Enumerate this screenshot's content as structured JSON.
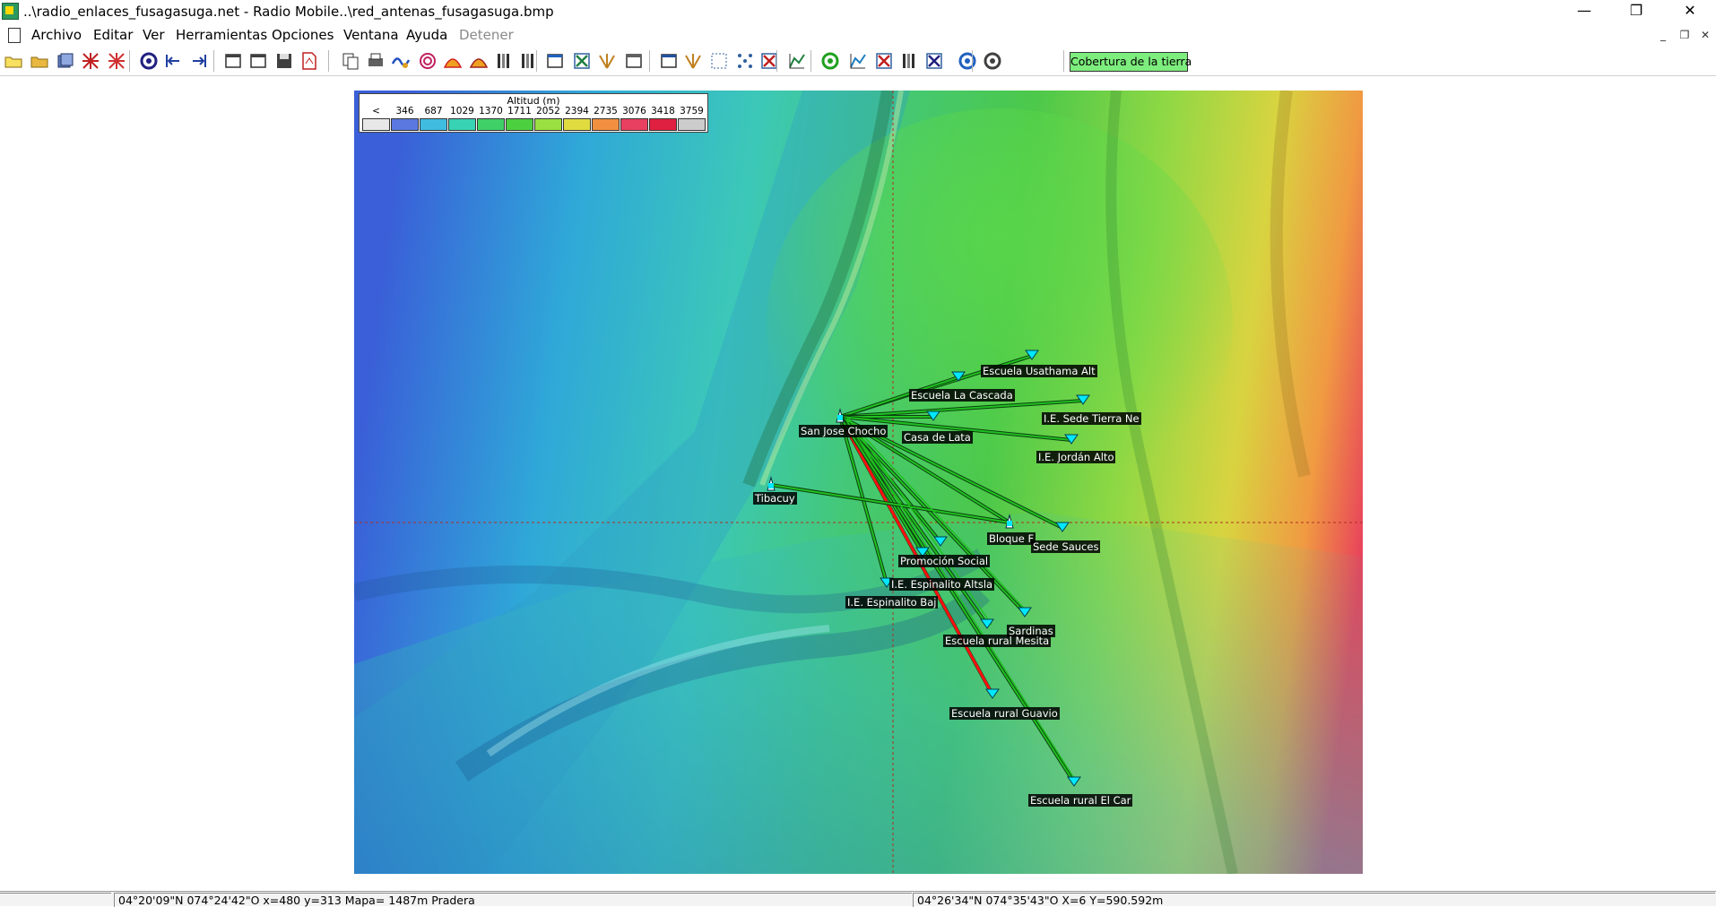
{
  "window": {
    "title": "..\\radio_enlaces_fusagasuga.net - Radio Mobile..\\red_antenas_fusagasuga.bmp",
    "minimize_glyph": "—",
    "restore_glyph": "❐",
    "close_glyph": "✕"
  },
  "menu": {
    "items": [
      {
        "label": "Archivo"
      },
      {
        "label": "Editar"
      },
      {
        "label": "Ver"
      },
      {
        "label": "Herramientas"
      },
      {
        "label": "Opciones"
      },
      {
        "label": "Ventana"
      },
      {
        "label": "Ayuda"
      },
      {
        "label": "Detener"
      }
    ],
    "mdi_minimize": "_",
    "mdi_restore": "❐",
    "mdi_close": "✕"
  },
  "toolbar": {
    "coverage_button": "Cobertura de la tierra",
    "icons": [
      "new-icon",
      "open-icon",
      "save-all-icon",
      "network-icon",
      "antenna-icon",
      "globe-icon",
      "first-icon",
      "last-icon",
      "window-icon",
      "export-icon",
      "disk-icon",
      "pdf-icon",
      "copy-icon",
      "print-icon",
      "cut-icon",
      "target-icon",
      "gradient-icon",
      "elevation-icon",
      "legend-icon",
      "grid-icon",
      "map-icon",
      "rose-icon",
      "merge-icon",
      "window2-icon",
      "picture-icon",
      "person-icon",
      "fit-icon",
      "points-icon",
      "close-map-icon",
      "profile-icon",
      "compass-icon",
      "chart-icon",
      "link-icon",
      "barcode-icon",
      "route-icon",
      "earth-icon",
      "coverage-icon"
    ]
  },
  "legend": {
    "title": "Altitud (m)",
    "lt": "<",
    "values": [
      "346",
      "687",
      "1029",
      "1370",
      "1711",
      "2052",
      "2394",
      "2735",
      "3076",
      "3418",
      "3759"
    ],
    "colors": [
      "#e8e8e8",
      "#5a78e0",
      "#3fbce0",
      "#38d2b4",
      "#3fd068",
      "#4cd040",
      "#9ae040",
      "#e0dc40",
      "#f09040",
      "#e84060",
      "#e02040"
    ]
  },
  "sites": [
    {
      "name": "Escuela Usathama Alt"
    },
    {
      "name": "Escuela La Cascada"
    },
    {
      "name": "I.E. Sede Tierra Ne"
    },
    {
      "name": "San Jose Chocho"
    },
    {
      "name": "Casa de Lata"
    },
    {
      "name": "I.E. Jordán Alto"
    },
    {
      "name": "Tibacuy"
    },
    {
      "name": "Bloque F"
    },
    {
      "name": "Sede Sauces"
    },
    {
      "name": "Promoción Social"
    },
    {
      "name": "I.E. Espinalito Altsla"
    },
    {
      "name": "I.E. Espinalito Baj"
    },
    {
      "name": "Sardinas"
    },
    {
      "name": "Escuela rural Mesita"
    },
    {
      "name": "Escuela rural Guavio"
    },
    {
      "name": "Escuela rural El Car"
    }
  ],
  "link_colors": {
    "ok": "#20c020",
    "fail": "#ff1010",
    "site": "#00e8ff"
  },
  "status": {
    "pane1": "",
    "pane2": "04°20'09\"N  074°24'42\"O   x=480 y=313 Mapa= 1487m Pradera",
    "pane3": "04°26'34\"N  074°35'43\"O  X=6 Y=590.592m"
  }
}
